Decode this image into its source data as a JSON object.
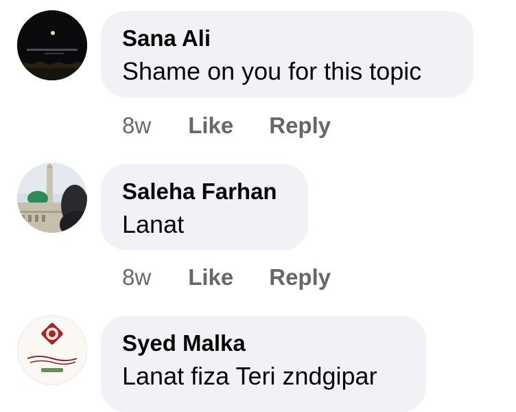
{
  "comments": [
    {
      "author": "Sana Ali",
      "text": "Shame on you for this topic",
      "time": "8w",
      "like_label": "Like",
      "reply_label": "Reply",
      "avatar_icon": "night-sky-moon-avatar"
    },
    {
      "author": "Saleha Farhan",
      "text": "Lanat",
      "time": "8w",
      "like_label": "Like",
      "reply_label": "Reply",
      "avatar_icon": "green-dome-mosque-avatar"
    },
    {
      "author": "Syed Malka",
      "text": "Lanat fiza Teri zndgipar",
      "avatar_icon": "calligraphy-emblem-avatar"
    }
  ],
  "colors": {
    "bubble_bg": "#f0f2f5",
    "meta_text": "#65676b",
    "text": "#050505"
  }
}
